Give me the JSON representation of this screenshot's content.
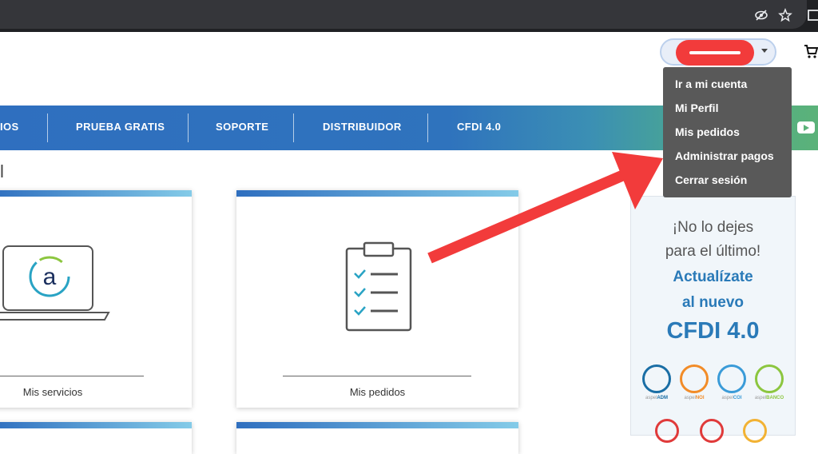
{
  "browser": {
    "icons": [
      "eye-off-icon",
      "star-icon",
      "window-icon"
    ]
  },
  "header": {
    "user_menu": {
      "redacted": true,
      "items": [
        {
          "label": "Ir a mi cuenta"
        },
        {
          "label": "Mi Perfil"
        },
        {
          "label": "Mis pedidos"
        },
        {
          "label": "Administrar pagos"
        },
        {
          "label": "Cerrar sesión"
        }
      ]
    },
    "cart_icon": "cart-icon"
  },
  "nav": {
    "items": [
      {
        "label": "IOS"
      },
      {
        "label": "PRUEBA GRATIS"
      },
      {
        "label": "SOPORTE"
      },
      {
        "label": "DISTRIBUIDOR"
      },
      {
        "label": "CFDI 4.0"
      }
    ],
    "social_icon": "youtube-icon"
  },
  "main": {
    "section_title": "l",
    "cards": [
      {
        "label": "Mis servicios",
        "icon": "laptop-logo-icon"
      },
      {
        "label": "Mis pedidos",
        "icon": "clipboard-checklist-icon"
      }
    ]
  },
  "promo": {
    "line1": "¡No lo dejes",
    "line2": "para el último!",
    "line3": "Actualízate",
    "line4": "al nuevo",
    "line5": "CFDI 4.0",
    "apps": [
      {
        "label_prefix": "aspel",
        "label_name": "ADM",
        "color": "#1a6ea5"
      },
      {
        "label_prefix": "aspel",
        "label_name": "NOI",
        "color": "#f28c28"
      },
      {
        "label_prefix": "aspel",
        "label_name": "COI",
        "color": "#3a9bd8"
      },
      {
        "label_prefix": "aspel",
        "label_name": "BANCO",
        "color": "#8cc63f"
      }
    ]
  },
  "colors": {
    "accent": "#2f73bd",
    "annotation_arrow": "#f23b3b",
    "dropdown_bg": "#595959",
    "promo_blue": "#2a7ab8"
  }
}
